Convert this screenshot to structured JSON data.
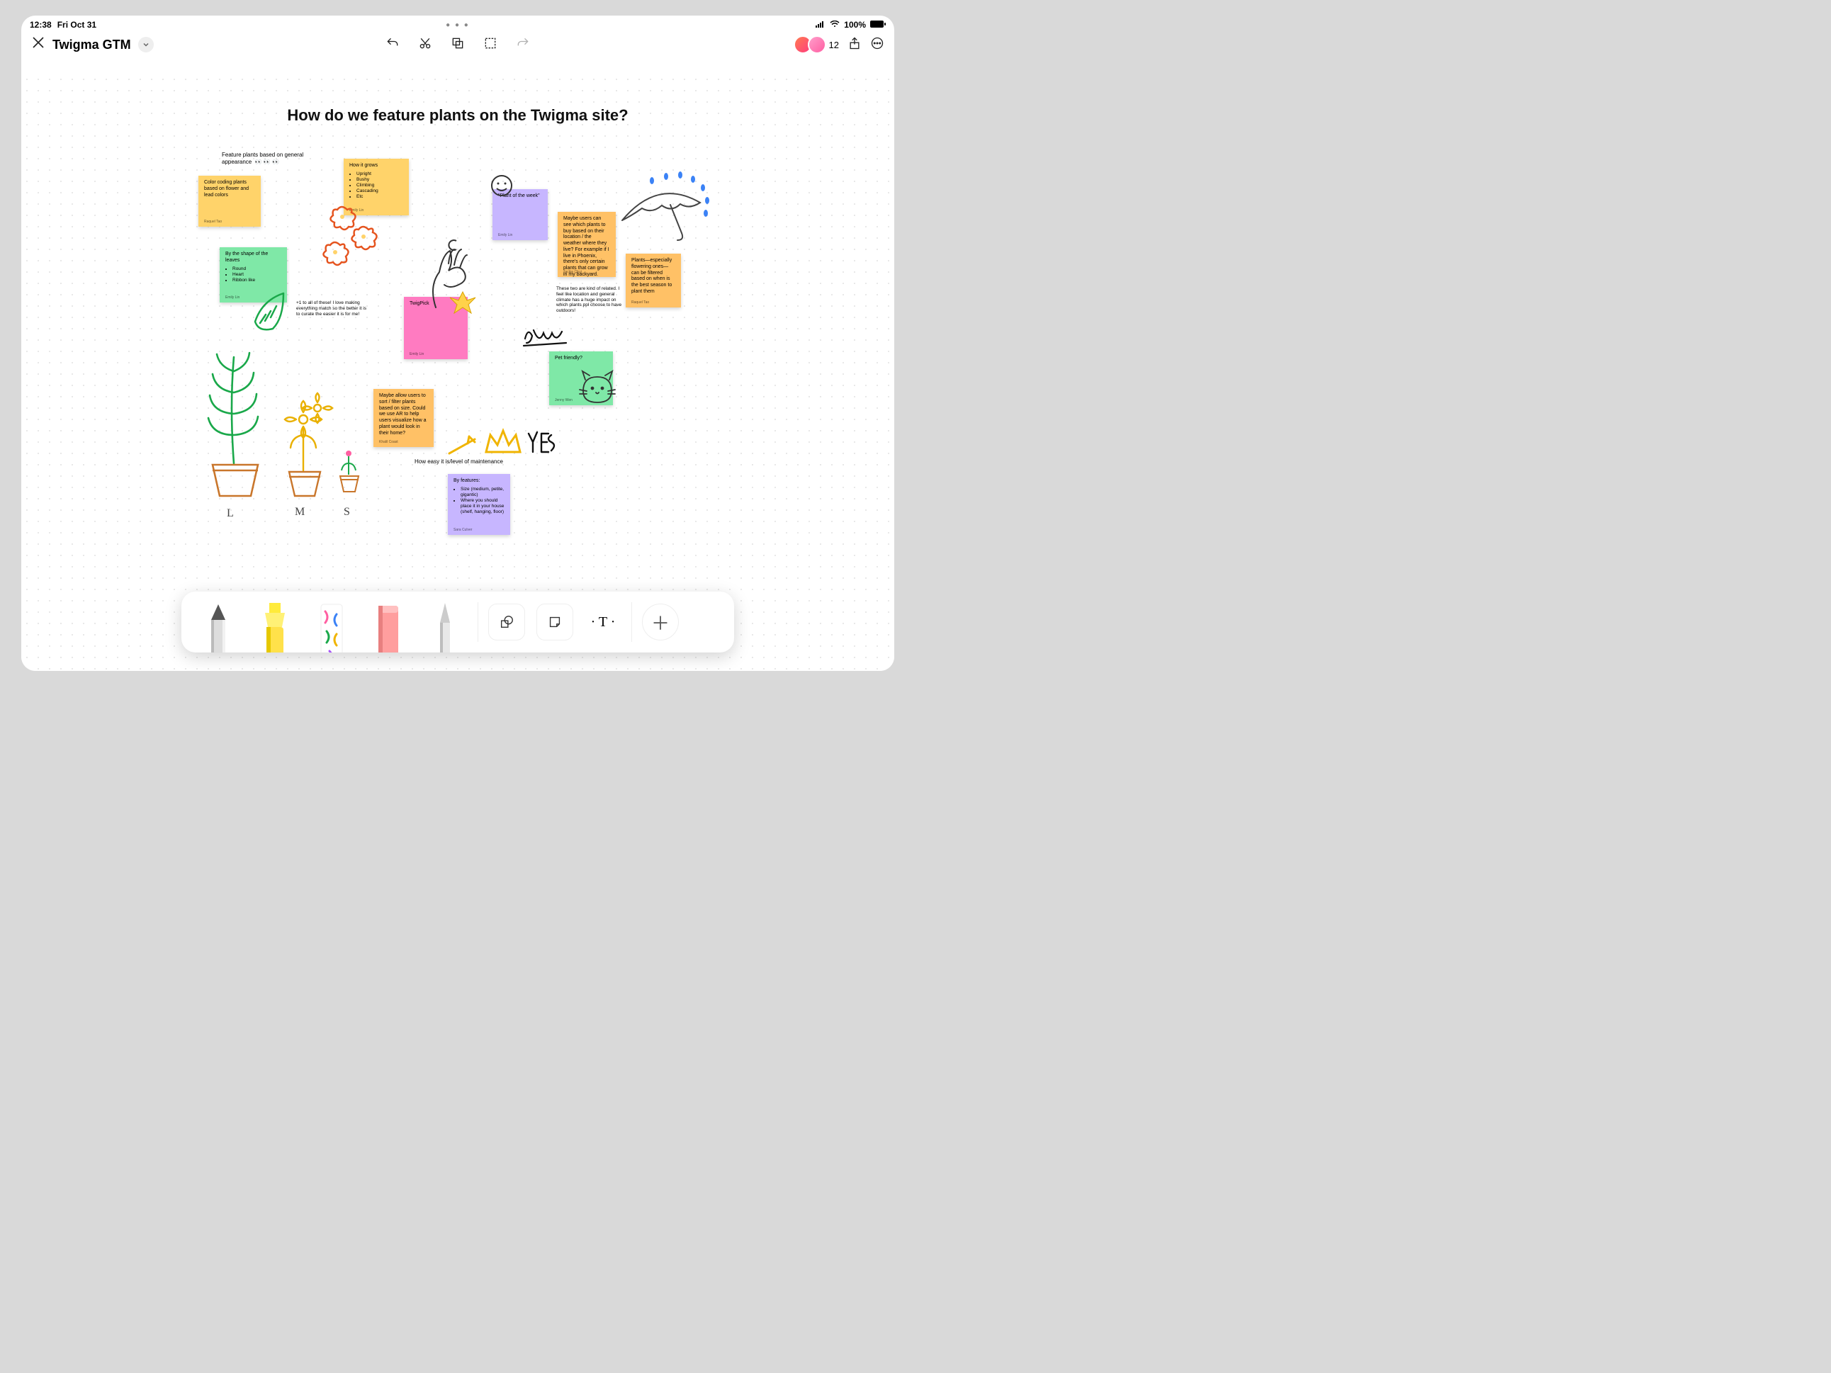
{
  "status": {
    "time": "12:38",
    "date": "Fri Oct 31",
    "battery_pct": "100%"
  },
  "appbar": {
    "doc_title": "Twigma GTM",
    "collab_count": "12"
  },
  "canvas": {
    "title": "How do we feature plants on the Twigma site?",
    "freetext_1": "Feature plants based on general appearance",
    "freetext_eyes": "👀 👀 👀",
    "freetext_2": "These two are kind of related. I feel like location and general climate has a huge impact on which plants ppl choose to have outdoors!",
    "freetext_3": "How easy it is/level of maintenance",
    "freetext_4": "+1 to all of these! I love making everything match so the better it is to curate the easier it is for me!",
    "label_L": "L",
    "label_M": "M",
    "label_S": "S",
    "notes": {
      "n1": {
        "body": "Color coding plants based on flower and lead colors",
        "author": "Raquel Tao"
      },
      "n2_title": "How it grows",
      "n2_items": [
        "Upright",
        "Bushy",
        "Climbing",
        "Cascading",
        "Etc"
      ],
      "n2_author": "Emily Lin",
      "n3_title": "By the shape of the leaves",
      "n3_items": [
        "Round",
        "Heart",
        "Ribbon like"
      ],
      "n3_author": "Emily Lin",
      "n4": {
        "body": "\"Plant of the week\"",
        "author": "Emily Lin"
      },
      "n5": {
        "body": "Maybe users can see which plants to buy based on their location / the weather where they live? For example if I live in Phoenix, there's only certain plants that can grow in my backyard.",
        "author": "Jackie Chui"
      },
      "n6": {
        "body": "Plants—especially flowering ones—can be filtered based on when is the best season to plant them",
        "author": "Raquel Tao"
      },
      "n7": {
        "body": "TwigPick",
        "author": "Emily Lin"
      },
      "n8": {
        "body": "Pet friendly?",
        "author": "Jenny Wen"
      },
      "n9": {
        "body": "Maybe allow users to sort / filter plants based on size. Could we use AR to help users visualize how a plant would look in their home?",
        "author": "Khalil Coast"
      },
      "n10_title": "By features:",
      "n10_items": [
        "Size (medium, petite, gigantic)",
        "Where you should place it in your house (shelf, hanging, floor)"
      ],
      "n10_author": "Sara Culver"
    }
  },
  "toolbar": {
    "tools": [
      "pencil",
      "highlighter",
      "washi-tape",
      "eraser",
      "cutter"
    ],
    "buttons": [
      "shapes",
      "sticky-note",
      "text",
      "add"
    ]
  }
}
